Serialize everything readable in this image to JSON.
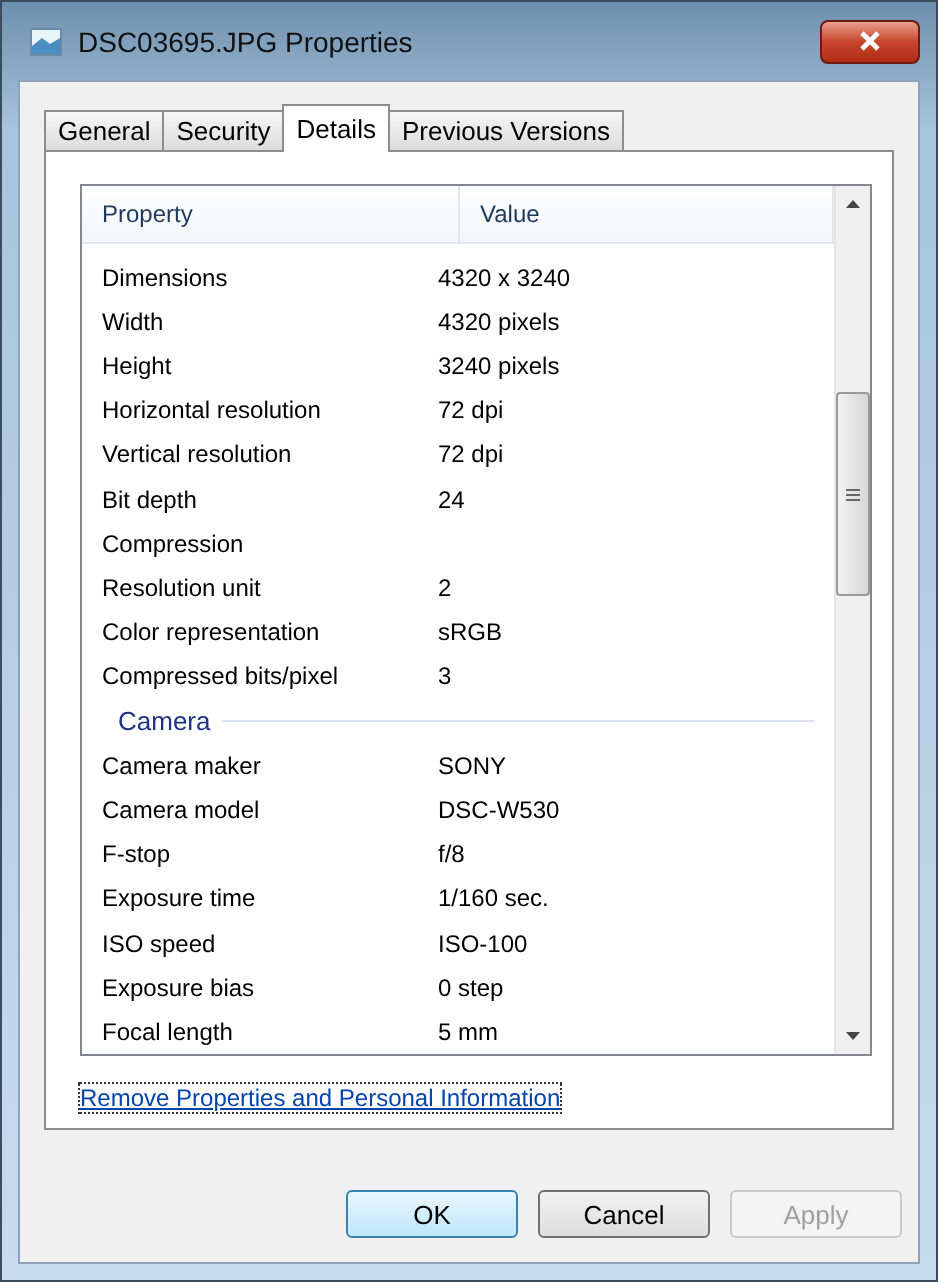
{
  "window": {
    "title": "DSC03695.JPG Properties"
  },
  "tabs": [
    {
      "label": "General",
      "selected": false
    },
    {
      "label": "Security",
      "selected": false
    },
    {
      "label": "Details",
      "selected": true
    },
    {
      "label": "Previous Versions",
      "selected": false
    }
  ],
  "table": {
    "columns": [
      "Property",
      "Value"
    ],
    "rows": [
      {
        "kind": "row",
        "property": "Dimensions",
        "value": "4320 x 3240"
      },
      {
        "kind": "row",
        "property": "Width",
        "value": "4320 pixels"
      },
      {
        "kind": "row",
        "property": "Height",
        "value": "3240 pixels"
      },
      {
        "kind": "row",
        "property": "Horizontal resolution",
        "value": "72 dpi"
      },
      {
        "kind": "row",
        "property": "Vertical resolution",
        "value": "72 dpi"
      },
      {
        "kind": "row",
        "property": "Bit depth",
        "value": "24"
      },
      {
        "kind": "row",
        "property": "Compression",
        "value": ""
      },
      {
        "kind": "row",
        "property": "Resolution unit",
        "value": "2"
      },
      {
        "kind": "row",
        "property": "Color representation",
        "value": "sRGB"
      },
      {
        "kind": "row",
        "property": "Compressed bits/pixel",
        "value": "3"
      },
      {
        "kind": "section",
        "property": "Camera"
      },
      {
        "kind": "row",
        "property": "Camera maker",
        "value": "SONY"
      },
      {
        "kind": "row",
        "property": "Camera model",
        "value": "DSC-W530"
      },
      {
        "kind": "row",
        "property": "F-stop",
        "value": "f/8"
      },
      {
        "kind": "row",
        "property": "Exposure time",
        "value": "1/160 sec."
      },
      {
        "kind": "row",
        "property": "ISO speed",
        "value": "ISO-100"
      },
      {
        "kind": "row",
        "property": "Exposure bias",
        "value": "0 step"
      },
      {
        "kind": "row",
        "property": "Focal length",
        "value": "5 mm"
      }
    ]
  },
  "link": "Remove Properties and Personal Information",
  "buttons": [
    {
      "label": "OK",
      "disabled": false,
      "default": true
    },
    {
      "label": "Cancel",
      "disabled": false,
      "default": false
    },
    {
      "label": "Apply",
      "disabled": true,
      "default": false
    }
  ]
}
